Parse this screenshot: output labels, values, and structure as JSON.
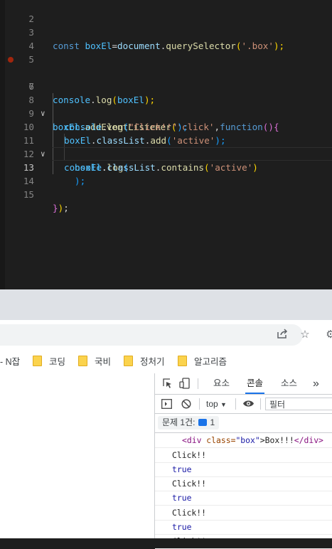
{
  "editor": {
    "line_numbers": [
      "2",
      "3",
      "4",
      "5",
      "6",
      "7",
      "8",
      "9",
      "10",
      "11",
      "12",
      "13",
      "14",
      "15"
    ],
    "current_line": "13",
    "lines": {
      "l3": [
        "const",
        " ",
        "boxEl",
        "=",
        "document",
        ".",
        "querySelector",
        "(",
        "'.box'",
        ");"
      ],
      "l6": [
        "console",
        ".",
        "log",
        "(",
        "boxEl",
        ");"
      ],
      "l8": [
        "boxEl",
        ".",
        "addEventListener",
        "(",
        "'click'",
        ",",
        "function",
        "()",
        "{"
      ],
      "l9": [
        "console",
        ".",
        "log",
        "(",
        "\"Click!!\"",
        ");"
      ],
      "l10": [
        "boxEl",
        ".",
        "classList",
        ".",
        "add",
        "(",
        "'active'",
        ");"
      ],
      "l11": [
        "console",
        ".",
        "log",
        "("
      ],
      "l12": [
        "boxEl",
        ".",
        "classList",
        ".",
        "contains",
        "(",
        "'active'",
        ")"
      ],
      "l13": [
        ");"
      ],
      "l15": [
        "}",
        ")",
        ";"
      ]
    }
  },
  "browser": {
    "bookmarks": [
      "N잡",
      "코딩",
      "국비",
      "정처기",
      "알고리즘"
    ],
    "toolbar_icons": [
      "share-icon",
      "star-icon",
      "extension-icon"
    ]
  },
  "devtools": {
    "tabs": [
      "요소",
      "콘솔",
      "소스"
    ],
    "active_tab": "콘솔",
    "more": "»",
    "context": "top",
    "filter_placeholder": "필터",
    "issues_label": "문제 1건:",
    "issues_count": "1",
    "messages": [
      {
        "type": "element",
        "tag_open": "<div",
        "attr_name": " class=",
        "attr_value": "\"box\"",
        "inner": ">Box!!!",
        "tag_close": "</div>"
      },
      {
        "type": "log",
        "text": "Click!!"
      },
      {
        "type": "bool",
        "text": "true"
      },
      {
        "type": "log",
        "text": "Click!!"
      },
      {
        "type": "bool",
        "text": "true"
      },
      {
        "type": "log",
        "text": "Click!!"
      },
      {
        "type": "bool",
        "text": "true"
      },
      {
        "type": "log",
        "text": "Click!!"
      }
    ]
  }
}
